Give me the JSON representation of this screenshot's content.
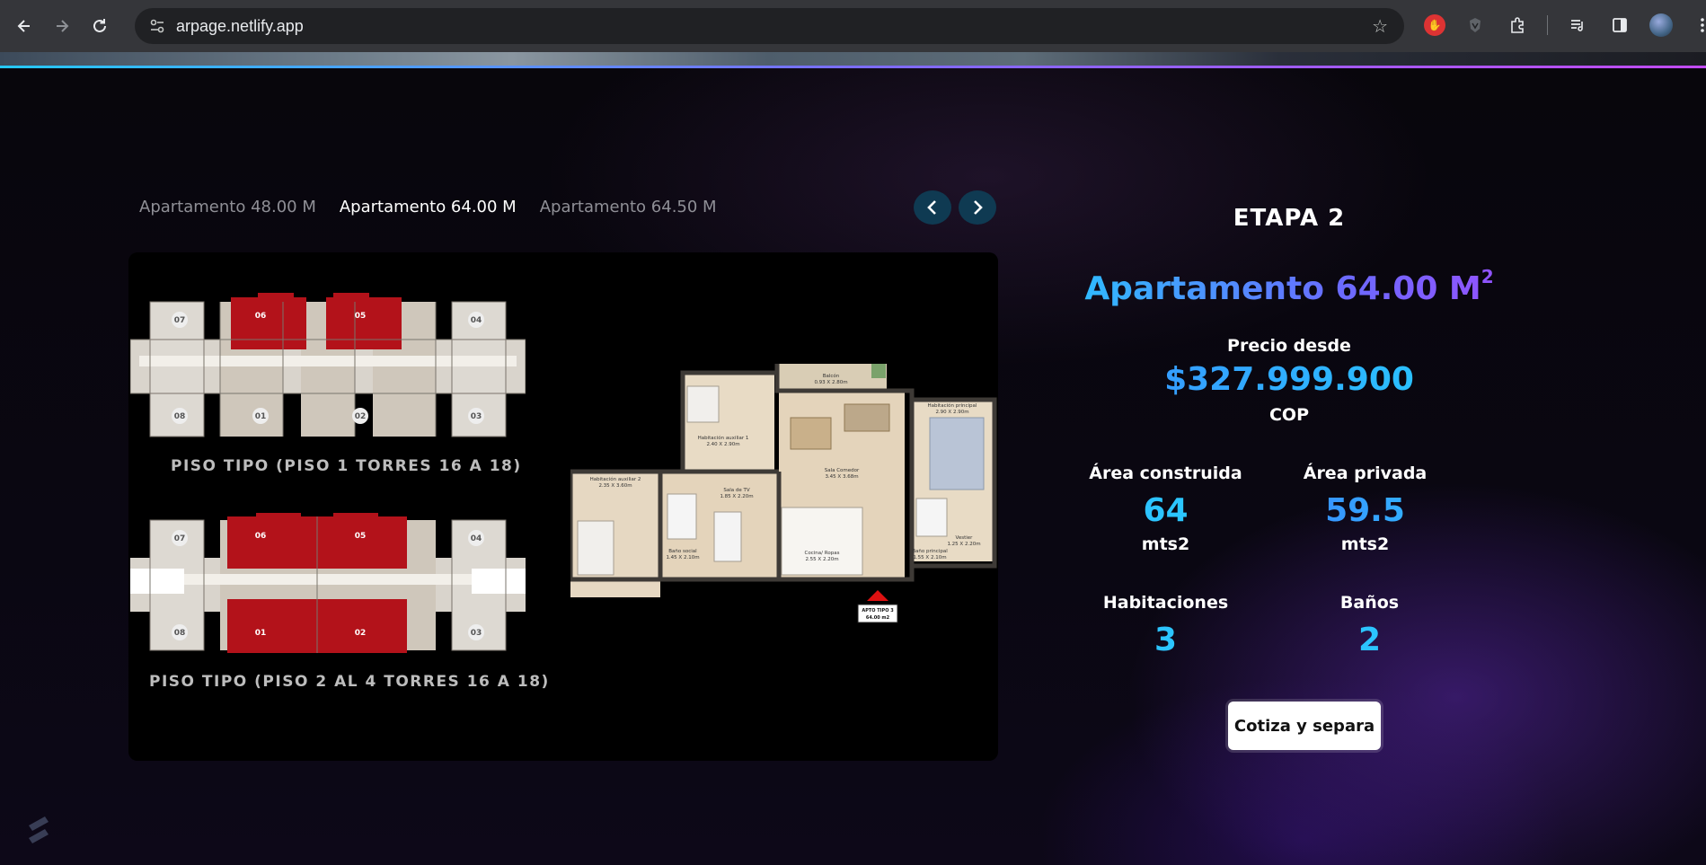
{
  "browser": {
    "url": "arpage.netlify.app"
  },
  "tabs": [
    {
      "label": "Apartamento 48.00 M",
      "active": false
    },
    {
      "label": "Apartamento 64.00 M",
      "active": true
    },
    {
      "label": "Apartamento 64.50 M",
      "active": false
    }
  ],
  "plan": {
    "caption_top": "PISO TIPO (PISO 1 TORRES 16 A 18)",
    "caption_bottom": "PISO TIPO (PISO 2 AL 4 TORRES 16 A 18)",
    "unit_numbers_top": [
      "07",
      "06",
      "05",
      "04",
      "08",
      "01",
      "02",
      "03"
    ],
    "unit_numbers_bottom": [
      "07",
      "06",
      "05",
      "04",
      "08",
      "01",
      "02",
      "03"
    ],
    "room_labels": {
      "balcon": "Balcón",
      "balcon_dim": "0.93 X 2.80m",
      "hab_aux1": "Habitación auxiliar 1",
      "hab_aux1_dim": "2.40 X 2.90m",
      "hab_principal": "Habitación principal",
      "hab_principal_dim": "2.90 X 2.90m",
      "sala_comedor": "Sala Comedor",
      "sala_comedor_dim": "3.45 X 3.68m",
      "hab_aux2": "Habitación auxiliar 2",
      "hab_aux2_dim": "2.35 X 3.60m",
      "sala_tv": "Sala de TV",
      "sala_tv_dim": "1.85 X 2.20m",
      "vestier": "Vestier",
      "vestier_dim": "1.25 X 2.20m",
      "bano_social": "Baño social",
      "bano_social_dim": "1.45 X 2.10m",
      "cocina": "Cocina/ Ropas",
      "cocina_dim": "2.55 X 2.20m",
      "bano_principal": "Baño principal",
      "bano_principal_dim": "1.55 X 2.10m",
      "apto_tag_1": "APTO TIPO 3",
      "apto_tag_2": "64.00 m2"
    }
  },
  "info": {
    "etapa": "ETAPA 2",
    "title": "Apartamento 64.00 M",
    "title_sup": "2",
    "price_label": "Precio desde",
    "price": "$327.999.900",
    "currency": "COP",
    "area_construida_label": "Área construida",
    "area_construida_value": "64",
    "area_construida_unit": "mts2",
    "area_privada_label": "Área privada",
    "area_privada_value": "59.5",
    "area_privada_unit": "mts2",
    "habitaciones_label": "Habitaciones",
    "habitaciones_value": "3",
    "banos_label": "Baños",
    "banos_value": "2",
    "cta_label": "Cotiza y separa"
  },
  "colors": {
    "accent_cyan": "#26c6ff",
    "accent_purple": "#9b4dff",
    "arrow_bg": "#0f3a52",
    "unit_red": "#b3121a"
  },
  "icons": [
    "back-arrow-icon",
    "forward-arrow-icon",
    "reload-icon",
    "site-settings-icon",
    "bookmark-star-icon",
    "stop-extension-icon",
    "brave-icon",
    "extensions-puzzle-icon",
    "media-icon",
    "side-panel-icon",
    "profile-avatar",
    "more-menu-icon",
    "chevron-left-icon",
    "chevron-right-icon",
    "site-logo-icon"
  ]
}
